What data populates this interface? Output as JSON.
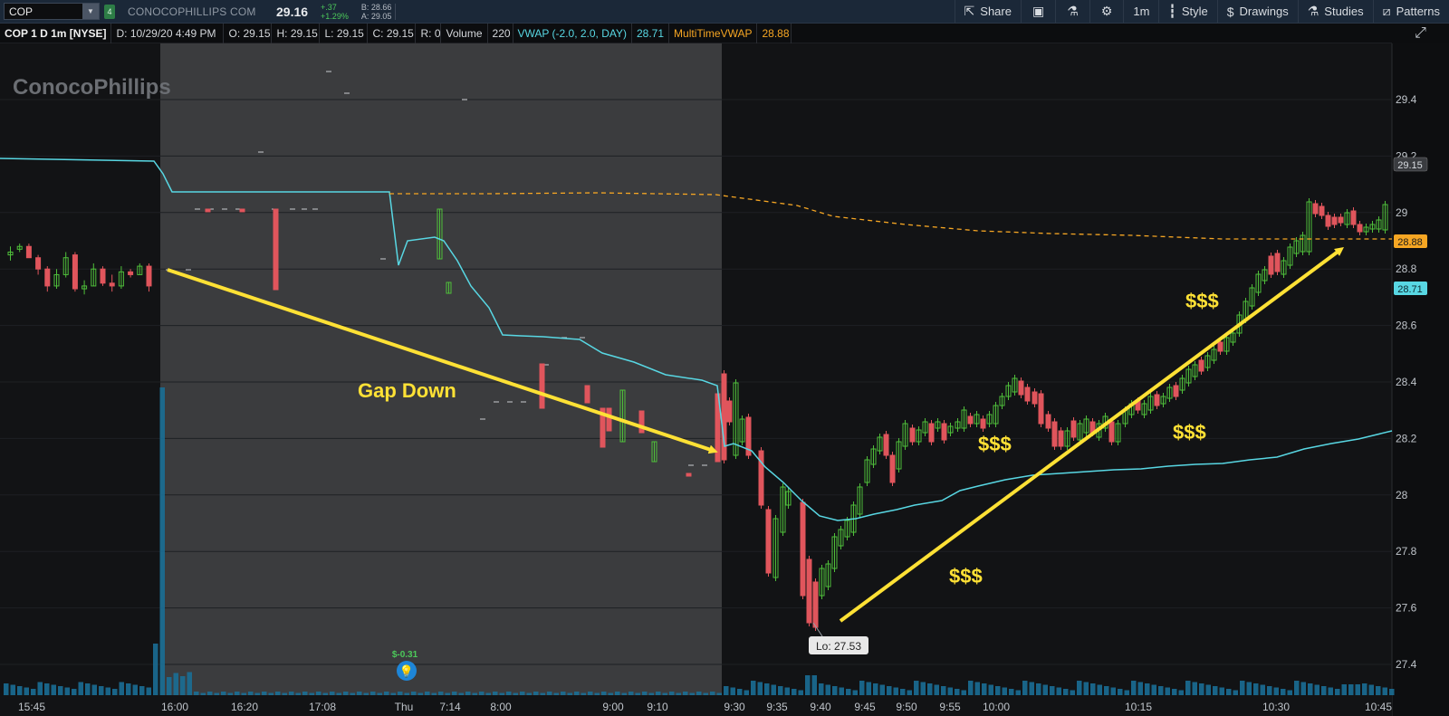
{
  "toolbar": {
    "symbol": "COP",
    "link_tag": "4",
    "company": "CONOCOPHILLIPS COM",
    "last_price": "29.16",
    "net_change": "+.37",
    "pct_change": "+1.29%",
    "bid": "B: 28.66",
    "ask": "A: 29.05",
    "buttons": {
      "share": "Share",
      "timeframe": "1m",
      "style": "Style",
      "drawings": "Drawings",
      "studies": "Studies",
      "patterns": "Patterns"
    }
  },
  "inforow": {
    "title": "COP 1 D 1m [NYSE]",
    "date": "D: 10/29/20 4:49 PM",
    "open": "O: 29.15",
    "high": "H: 29.15",
    "low": "L: 29.15",
    "close": "C: 29.15",
    "range": "R: 0",
    "volume_label": "Volume",
    "volume_value": "220",
    "vwap_label": "VWAP (-2.0, 2.0, DAY)",
    "vwap_value": "28.71",
    "mtvwap_label": "MultiTimeVWAP",
    "mtvwap_value": "28.88"
  },
  "colors": {
    "up": "#4fbf3a",
    "down": "#e0555c",
    "vwap": "#58d7e3",
    "mtvwap": "#f6a623",
    "annotation": "#ffe135",
    "volume": "#1b6e95"
  },
  "chart_data": {
    "type": "candlestick",
    "symbol": "COP",
    "aggregation": "1m",
    "y_range": [
      27.35,
      29.6
    ],
    "y_ticks": [
      27.4,
      27.6,
      27.8,
      28,
      28.2,
      28.4,
      28.6,
      28.8,
      29,
      29.2,
      29.4
    ],
    "x_ticks": [
      "15:45",
      "16:00",
      "16:20",
      "17:08",
      "Thu",
      "7:14",
      "8:00",
      "9:00",
      "9:10",
      "9:30",
      "9:35",
      "9:40",
      "9:45",
      "9:50",
      "9:55",
      "10:00",
      "10:15",
      "10:30",
      "10:45"
    ],
    "price_labels": {
      "last": "29.15",
      "mtvwap": "28.88",
      "vwap": "28.71"
    },
    "low_label": "Lo: 27.53",
    "dividend_label": "$-0.31",
    "watermark": "ConocoPhillips",
    "annotations": [
      {
        "text": "Gap Down"
      },
      {
        "text": "$$$"
      },
      {
        "text": "$$$"
      },
      {
        "text": "$$$"
      },
      {
        "text": "$$$"
      }
    ],
    "vwap_values": [
      29.17,
      29.16,
      29.15,
      29.14,
      29.13,
      29.1,
      29.05,
      29.05,
      29.05,
      29.05,
      29.05,
      28.8,
      28.9,
      28.88,
      28.7,
      28.56,
      28.55,
      28.5,
      28.43,
      28.4,
      28.37,
      28.18,
      28.15,
      28.0,
      27.92,
      27.92,
      27.96,
      28.0,
      28.06,
      28.1,
      28.12,
      28.14,
      28.16,
      28.18,
      28.2,
      28.23
    ],
    "mtvwap_values": [
      29.05,
      29.05,
      29.05,
      29.04,
      29.0,
      28.97,
      28.95,
      28.92,
      28.9,
      28.89,
      28.88,
      28.88,
      28.88
    ],
    "candles": [
      {
        "t": 0,
        "o": 28.85,
        "h": 28.88,
        "l": 28.83,
        "c": 28.86
      },
      {
        "t": 1,
        "o": 28.87,
        "h": 28.89,
        "l": 28.86,
        "c": 28.88
      },
      {
        "t": 2,
        "o": 28.88,
        "h": 28.89,
        "l": 28.84,
        "c": 28.84
      },
      {
        "t": 3,
        "o": 28.84,
        "h": 28.85,
        "l": 28.78,
        "c": 28.8
      },
      {
        "t": 4,
        "o": 28.8,
        "h": 28.81,
        "l": 28.72,
        "c": 28.74
      },
      {
        "t": 5,
        "o": 28.74,
        "h": 28.8,
        "l": 28.73,
        "c": 28.78
      },
      {
        "t": 6,
        "o": 28.78,
        "h": 28.86,
        "l": 28.77,
        "c": 28.84
      },
      {
        "t": 7,
        "o": 28.85,
        "h": 28.86,
        "l": 28.72,
        "c": 28.73
      },
      {
        "t": 8,
        "o": 28.73,
        "h": 28.76,
        "l": 28.71,
        "c": 28.74
      },
      {
        "t": 9,
        "o": 28.74,
        "h": 28.82,
        "l": 28.74,
        "c": 28.8
      },
      {
        "t": 10,
        "o": 28.8,
        "h": 28.81,
        "l": 28.74,
        "c": 28.75
      },
      {
        "t": 11,
        "o": 28.75,
        "h": 28.78,
        "l": 28.72,
        "c": 28.74
      },
      {
        "t": 12,
        "o": 28.74,
        "h": 28.81,
        "l": 28.73,
        "c": 28.79
      },
      {
        "t": 13,
        "o": 28.79,
        "h": 28.8,
        "l": 28.77,
        "c": 28.78
      },
      {
        "t": 14,
        "o": 28.78,
        "h": 28.82,
        "l": 28.78,
        "c": 28.81
      },
      {
        "t": 15,
        "o": 28.81,
        "h": 28.82,
        "l": 28.72,
        "c": 28.74
      }
    ]
  }
}
